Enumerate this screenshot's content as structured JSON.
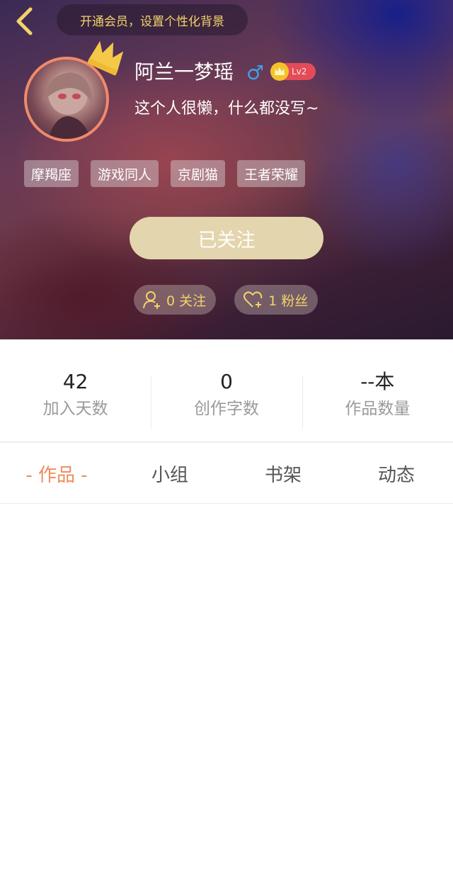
{
  "header": {
    "vip_banner": "开通会员，设置个性化背景"
  },
  "profile": {
    "username": "阿兰一梦瑶",
    "gender_symbol": "♂",
    "level": "Lv2",
    "bio": "这个人很懒，什么都没写~",
    "tags": [
      "摩羯座",
      "游戏同人",
      "京剧猫",
      "王者荣耀"
    ],
    "follow_button": "已关注",
    "following": "0 关注",
    "fans": "1 粉丝"
  },
  "stats": [
    {
      "value": "42",
      "label": "加入天数"
    },
    {
      "value": "0",
      "label": "创作字数"
    },
    {
      "value": "--本",
      "label": "作品数量"
    }
  ],
  "tabs": [
    {
      "label": "- 作品 -",
      "active": true
    },
    {
      "label": "小组",
      "active": false
    },
    {
      "label": "书架",
      "active": false
    },
    {
      "label": "动态",
      "active": false
    }
  ],
  "colors": {
    "accent": "#ef8c5a",
    "gold": "#f3d36a",
    "follow_button": "#e3d5ad",
    "gender": "#3fa0e6",
    "level_badge": "#e24c58"
  },
  "icons": {
    "back": "chevron-left-icon",
    "crown": "crown-icon",
    "gender": "male-icon",
    "following": "user-add-icon",
    "fans": "heart-add-icon"
  }
}
